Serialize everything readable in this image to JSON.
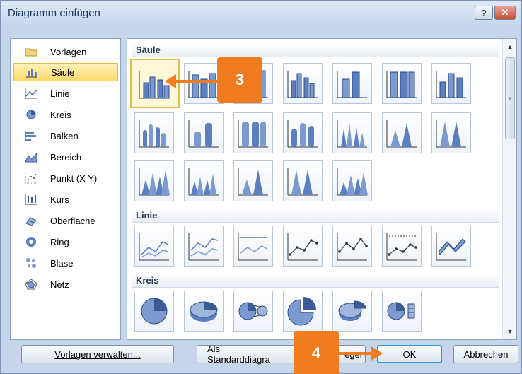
{
  "window": {
    "title": "Diagramm einfügen",
    "help_label": "?",
    "close_label": "✕"
  },
  "categories": [
    {
      "label": "Vorlagen",
      "icon": "folder-icon",
      "selected": false
    },
    {
      "label": "Säule",
      "icon": "column-chart-icon",
      "selected": true
    },
    {
      "label": "Linie",
      "icon": "line-chart-icon",
      "selected": false
    },
    {
      "label": "Kreis",
      "icon": "pie-chart-icon",
      "selected": false
    },
    {
      "label": "Balken",
      "icon": "bar-chart-icon",
      "selected": false
    },
    {
      "label": "Bereich",
      "icon": "area-chart-icon",
      "selected": false
    },
    {
      "label": "Punkt (X Y)",
      "icon": "scatter-chart-icon",
      "selected": false
    },
    {
      "label": "Kurs",
      "icon": "stock-chart-icon",
      "selected": false
    },
    {
      "label": "Oberfläche",
      "icon": "surface-chart-icon",
      "selected": false
    },
    {
      "label": "Ring",
      "icon": "doughnut-chart-icon",
      "selected": false
    },
    {
      "label": "Blase",
      "icon": "bubble-chart-icon",
      "selected": false
    },
    {
      "label": "Netz",
      "icon": "radar-chart-icon",
      "selected": false
    }
  ],
  "sections": {
    "saeule": "Säule",
    "linie": "Linie",
    "kreis": "Kreis"
  },
  "buttons": {
    "manage_templates": "Vorlagen verwalten...",
    "set_default_prefix": "Als Standarddiagra",
    "set_default_suffix": "egen",
    "ok": "OK",
    "cancel": "Abbrechen"
  },
  "annotations": {
    "step3": "3",
    "step4": "4"
  },
  "colors": {
    "accent_orange": "#f07c1f",
    "selection_yellow": "#fcd96b",
    "chart_blue": "#5b7fbf"
  }
}
